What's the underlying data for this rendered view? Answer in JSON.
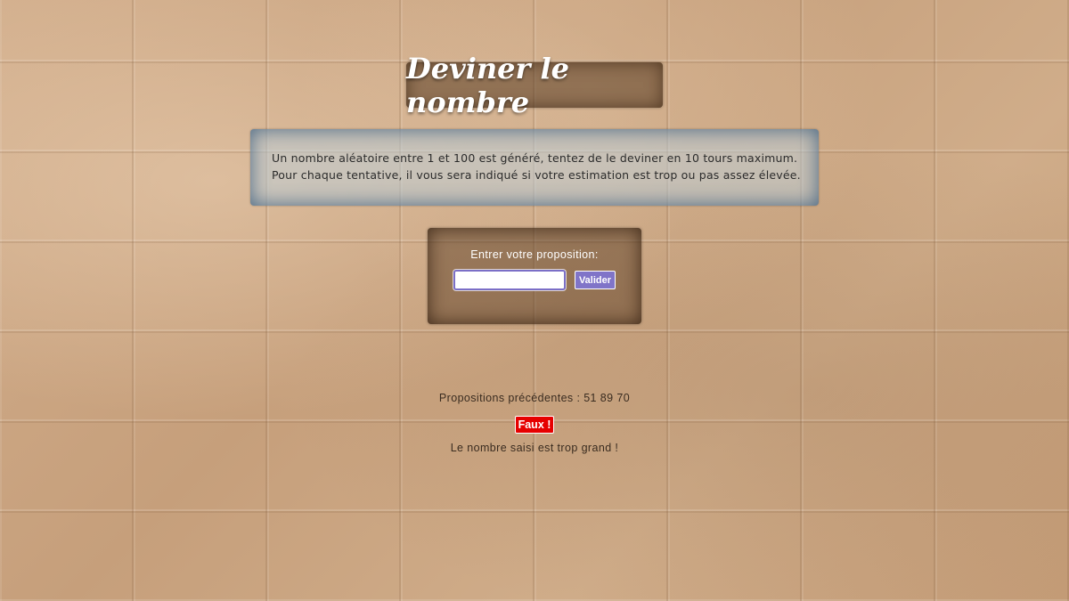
{
  "header": {
    "title": "Deviner le nombre"
  },
  "intro": {
    "line1": "Un nombre aléatoire entre 1 et 100 est généré, tentez de le deviner en 10 tours maximum.",
    "line2": "Pour chaque tentative, il vous sera indiqué si votre estimation est trop ou pas assez élevée."
  },
  "form": {
    "label": "Entrer votre proposition:",
    "input_value": "",
    "submit_label": "Valider"
  },
  "results": {
    "previous_guesses": "Propositions précédentes : 51 89 70",
    "status_badge": "Faux !",
    "message": "Le nombre saisi est trop grand !"
  },
  "colors": {
    "badge_bg": "#e60000",
    "button_bg": "#8074c8",
    "input_border": "#7b6fc7"
  }
}
